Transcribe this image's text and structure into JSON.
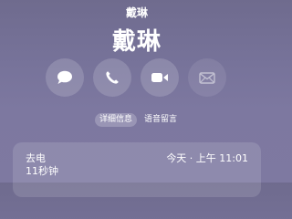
{
  "contact": {
    "small_name": "戴琳",
    "name": "戴琳"
  },
  "actions": [
    {
      "label": "message",
      "icon": "message-icon",
      "enabled": true
    },
    {
      "label": "call",
      "icon": "phone-icon",
      "enabled": true
    },
    {
      "label": "video",
      "icon": "video-icon",
      "enabled": true
    },
    {
      "label": "mail",
      "icon": "mail-icon",
      "enabled": false
    }
  ],
  "tabs": [
    {
      "label": "详细信息",
      "active": true
    },
    {
      "label": "语音留言",
      "active": false
    }
  ],
  "recent_call": {
    "type": "去电",
    "duration": "11秒钟",
    "time": "今天 · 上午 11:01"
  }
}
